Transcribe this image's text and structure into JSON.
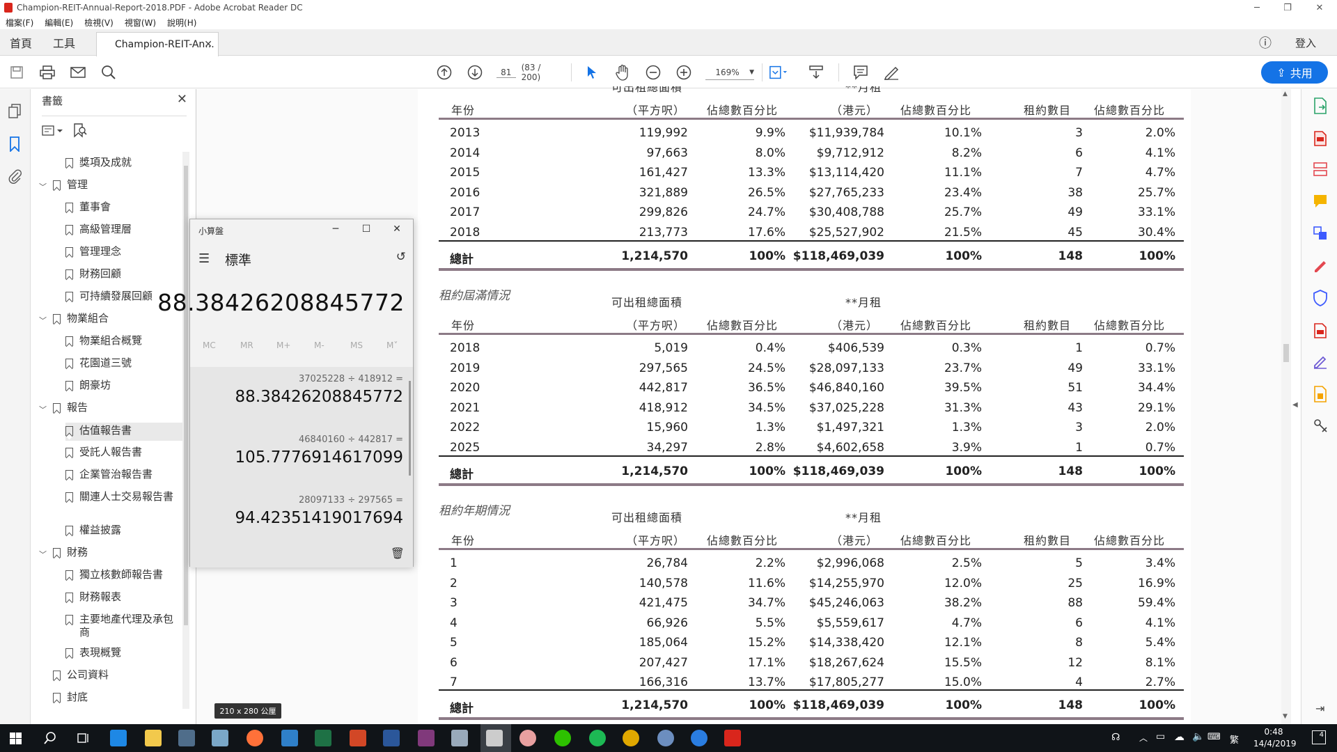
{
  "window": {
    "title": "Champion-REIT-Annual-Report-2018.PDF - Adobe Acrobat Reader DC"
  },
  "menu": [
    "檔案(F)",
    "編輯(E)",
    "檢視(V)",
    "視窗(W)",
    "說明(H)"
  ],
  "tabs": {
    "home": "首頁",
    "tools": "工具",
    "doc": "Champion-REIT-An...",
    "login": "登入"
  },
  "toolbar": {
    "page_current": "81",
    "page_info": "(83 / 200)",
    "zoom": "169%",
    "share_label": "共用"
  },
  "bookmarks": {
    "title": "書籤",
    "items": [
      "獎項及成就",
      "管理",
      "董事會",
      "高級管理層",
      "管理理念",
      "財務回顧",
      "可持續發展回顧",
      "物業組合",
      "物業組合概覽",
      "花園道三號",
      "朗豪坊",
      "報告",
      "估值報告書",
      "受託人報告書",
      "企業管治報告書",
      "關連人士交易報告書",
      "權益披露",
      "財務",
      "獨立核數師報告書",
      "財務報表",
      "主要地產代理及承包商",
      "表現概覽",
      "公司資料",
      "封底"
    ]
  },
  "calculator": {
    "title": "小算盤",
    "mode": "標準",
    "display": "88.38426208845772",
    "memory": [
      "MC",
      "MR",
      "M+",
      "M-",
      "MS",
      "M˅"
    ],
    "history": [
      {
        "expr": "37025228 ÷ 418912 =",
        "result": "88.38426208845772"
      },
      {
        "expr": "46840160 ÷ 442817 =",
        "result": "105.7776914617099"
      },
      {
        "expr": "28097133 ÷ 297565 =",
        "result": "94.42351419017694"
      }
    ]
  },
  "page_size": "210 x 280 公厘",
  "table": {
    "header": {
      "area1": "可出租總面積",
      "area2": "（平方呎）",
      "pct": "佔總數百分比",
      "rent1": "**月租",
      "rent2": "（港元）",
      "count": "租約數目",
      "year": "年份"
    },
    "top_header": {
      "area1": "可出租總面積",
      "rent1": "**月租"
    },
    "total_label": "總計",
    "section1": {
      "rows": [
        [
          "2013",
          "119,992",
          "9.9%",
          "$11,939,784",
          "10.1%",
          "3",
          "2.0%"
        ],
        [
          "2014",
          "97,663",
          "8.0%",
          "$9,712,912",
          "8.2%",
          "6",
          "4.1%"
        ],
        [
          "2015",
          "161,427",
          "13.3%",
          "$13,114,420",
          "11.1%",
          "7",
          "4.7%"
        ],
        [
          "2016",
          "321,889",
          "26.5%",
          "$27,765,233",
          "23.4%",
          "38",
          "25.7%"
        ],
        [
          "2017",
          "299,826",
          "24.7%",
          "$30,408,788",
          "25.7%",
          "49",
          "33.1%"
        ],
        [
          "2018",
          "213,773",
          "17.6%",
          "$25,527,902",
          "21.5%",
          "45",
          "30.4%"
        ]
      ],
      "total": [
        "1,214,570",
        "100%",
        "$118,469,039",
        "100%",
        "148",
        "100%"
      ]
    },
    "section2": {
      "title": "租約屆滿情況",
      "rows": [
        [
          "2018",
          "5,019",
          "0.4%",
          "$406,539",
          "0.3%",
          "1",
          "0.7%"
        ],
        [
          "2019",
          "297,565",
          "24.5%",
          "$28,097,133",
          "23.7%",
          "49",
          "33.1%"
        ],
        [
          "2020",
          "442,817",
          "36.5%",
          "$46,840,160",
          "39.5%",
          "51",
          "34.4%"
        ],
        [
          "2021",
          "418,912",
          "34.5%",
          "$37,025,228",
          "31.3%",
          "43",
          "29.1%"
        ],
        [
          "2022",
          "15,960",
          "1.3%",
          "$1,497,321",
          "1.3%",
          "3",
          "2.0%"
        ],
        [
          "2025",
          "34,297",
          "2.8%",
          "$4,602,658",
          "3.9%",
          "1",
          "0.7%"
        ]
      ],
      "total": [
        "1,214,570",
        "100%",
        "$118,469,039",
        "100%",
        "148",
        "100%"
      ]
    },
    "section3": {
      "title": "租約年期情況",
      "rows": [
        [
          "1",
          "26,784",
          "2.2%",
          "$2,996,068",
          "2.5%",
          "5",
          "3.4%"
        ],
        [
          "2",
          "140,578",
          "11.6%",
          "$14,255,970",
          "12.0%",
          "25",
          "16.9%"
        ],
        [
          "3",
          "421,475",
          "34.7%",
          "$45,246,063",
          "38.2%",
          "88",
          "59.4%"
        ],
        [
          "4",
          "66,926",
          "5.5%",
          "$5,559,617",
          "4.7%",
          "6",
          "4.1%"
        ],
        [
          "5",
          "185,064",
          "15.2%",
          "$14,338,420",
          "12.1%",
          "8",
          "5.4%"
        ],
        [
          "6",
          "207,427",
          "17.1%",
          "$18,267,624",
          "15.5%",
          "12",
          "8.1%"
        ],
        [
          "7",
          "166,316",
          "13.7%",
          "$17,805,277",
          "15.0%",
          "4",
          "2.7%"
        ]
      ],
      "total": [
        "1,214,570",
        "100%",
        "$118,469,039",
        "100%",
        "148",
        "100%"
      ]
    }
  },
  "taskbar": {
    "ime": "繁",
    "time": "0:48",
    "date": "14/4/2019",
    "notifications": "4"
  },
  "colors": {
    "accent": "#1473e6",
    "rule": "#8c7a86",
    "pdf_red": "#d9261c",
    "taskbar": "#101418"
  }
}
